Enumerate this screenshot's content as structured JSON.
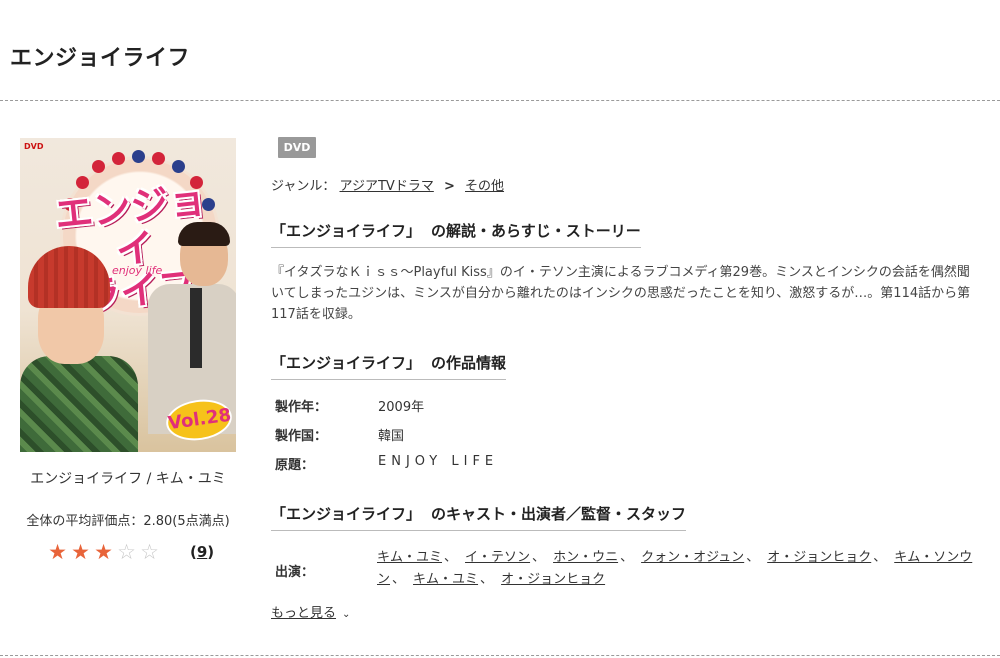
{
  "page_title": "エンジョイライフ",
  "cover": {
    "caption": "エンジョイライフ / キム・ユミ",
    "vol_label": "Vol.28",
    "dvd_mark": "DVD",
    "logo_text": "エンジョイ\nライフ",
    "logo_sub": "enjoy life"
  },
  "rating": {
    "avg_text": "全体の平均評価点：2.80(5点満点)",
    "full_stars": 3,
    "total_stars": 5,
    "count_open": "(",
    "count": "9",
    "count_close": ")"
  },
  "badge": "DVD",
  "genre": {
    "label": "ジャンル：",
    "items": [
      "アジアTVドラマ",
      "その他"
    ],
    "separator": ">"
  },
  "sections": {
    "synopsis_title": "「エンジョイライフ」",
    "synopsis_suffix": "の解説・あらすじ・ストーリー",
    "info_title": "「エンジョイライフ」",
    "info_suffix": "の作品情報",
    "cast_title": "「エンジョイライフ」",
    "cast_suffix": "のキャスト・出演者／監督・スタッフ"
  },
  "synopsis": "『イタズラなＫｉｓｓ～Playful Kiss』のイ・テソン主演によるラブコメディ第29巻。ミンスとインシクの会話を偶然聞いてしまったユジンは、ミンスが自分から離れたのはインシクの思惑だったことを知り、激怒するが…。第114話から第117話を収録。",
  "info": [
    {
      "label": "製作年：",
      "value": "2009年"
    },
    {
      "label": "製作国：",
      "value": "韓国"
    },
    {
      "label": "原題：",
      "value": "ENJOY LIFE"
    }
  ],
  "cast": {
    "label": "出演：",
    "members": [
      "キム・ユミ",
      "イ・テソン",
      "ホン・ウニ",
      "クォン・オジュン",
      "オ・ジョンヒョク",
      "キム・ソンウン",
      "キム・ユミ",
      "オ・ジョンヒョク"
    ]
  },
  "more_link": "もっと見る",
  "colors": {
    "star_full": "#e8643a",
    "star_empty": "#c8c8c8",
    "badge_bg": "#999999"
  }
}
